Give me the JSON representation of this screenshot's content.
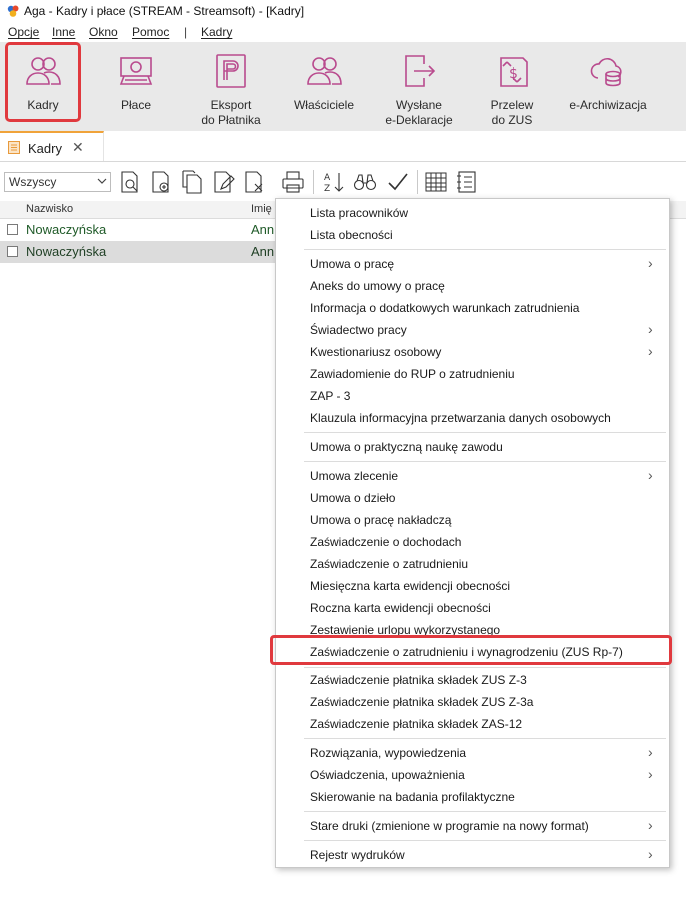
{
  "window": {
    "title": "Aga - Kadry i płace (STREAM - Streamsoft) - [Kadry]",
    "logo_icon": "aga-logo-icon"
  },
  "menubar": {
    "items": [
      {
        "label": "Opcje"
      },
      {
        "label": "Inne"
      },
      {
        "label": "Okno"
      },
      {
        "label": "Pomoc"
      }
    ],
    "separator": "|",
    "extra": {
      "label": "Kadry"
    }
  },
  "ribbon": {
    "buttons": [
      {
        "label": "Kadry",
        "icon": "people-icon",
        "selected": true
      },
      {
        "label": "Płace",
        "icon": "money-icon"
      },
      {
        "label": "Eksport\ndo Płatnika",
        "icon": "platnik-icon"
      },
      {
        "label": "Właściciele",
        "icon": "owner-icon"
      },
      {
        "label": "Wysłane\ne-Deklaracje",
        "icon": "export-doc-icon"
      },
      {
        "label": "Przelew\ndo ZUS",
        "icon": "transfer-icon"
      },
      {
        "label": "e-Archiwizacja",
        "icon": "database-cloud-icon"
      }
    ],
    "highlight_color": "#e0393e"
  },
  "tabs": [
    {
      "label": "Kadry",
      "close": "✕"
    }
  ],
  "toolbar": {
    "filter_value": "Wszyscy",
    "icons": [
      "preview-doc-icon",
      "add-doc-icon",
      "copy-doc-icon",
      "edit-doc-icon",
      "delete-doc-icon",
      "print-icon",
      "sort-az-icon",
      "binoculars-icon",
      "check-icon",
      "grid-icon",
      "list-settings-icon"
    ]
  },
  "grid": {
    "columns": [
      "Nazwisko",
      "Imię"
    ],
    "rows": [
      {
        "nazwisko": "Nowaczyńska",
        "imie": "Ann"
      },
      {
        "nazwisko": "Nowaczyńska",
        "imie": "Ann",
        "selected": true
      }
    ]
  },
  "context_menu": {
    "groups": [
      [
        {
          "label": "Lista pracowników"
        },
        {
          "label": "Lista obecności"
        }
      ],
      [
        {
          "label": "Umowa o pracę",
          "submenu": true
        },
        {
          "label": "Aneks do umowy o pracę"
        },
        {
          "label": "Informacja o dodatkowych warunkach zatrudnienia"
        },
        {
          "label": "Świadectwo pracy",
          "submenu": true
        },
        {
          "label": "Kwestionariusz osobowy",
          "submenu": true
        },
        {
          "label": "Zawiadomienie do RUP o zatrudnieniu"
        },
        {
          "label": "ZAP - 3"
        },
        {
          "label": "Klauzula informacyjna przetwarzania danych osobowych"
        }
      ],
      [
        {
          "label": "Umowa o praktyczną naukę zawodu"
        }
      ],
      [
        {
          "label": "Umowa zlecenie",
          "submenu": true
        },
        {
          "label": "Umowa o dzieło"
        },
        {
          "label": "Umowa o pracę nakładczą"
        },
        {
          "label": "Zaświadczenie o dochodach"
        },
        {
          "label": "Zaświadczenie o zatrudnieniu"
        },
        {
          "label": "Miesięczna karta ewidencji obecności"
        },
        {
          "label": "Roczna karta ewidencji obecności"
        },
        {
          "label": "Zestawienie urlopu wykorzystanego"
        },
        {
          "label": "Zaświadczenie o zatrudnieniu i wynagrodzeniu (ZUS Rp-7)",
          "highlighted": true
        }
      ],
      [
        {
          "label": "Zaświadczenie płatnika składek ZUS Z-3"
        },
        {
          "label": "Zaświadczenie płatnika składek ZUS Z-3a"
        },
        {
          "label": "Zaświadczenie płatnika składek ZAS-12"
        }
      ],
      [
        {
          "label": "Rozwiązania, wypowiedzenia",
          "submenu": true
        },
        {
          "label": "Oświadczenia, upoważnienia",
          "submenu": true
        },
        {
          "label": "Skierowanie na badania profilaktyczne"
        }
      ],
      [
        {
          "label": "Stare druki (zmienione w programie na nowy format)",
          "submenu": true
        }
      ],
      [
        {
          "label": "Rejestr wydruków",
          "submenu": true
        }
      ]
    ],
    "submenu_glyph": "›",
    "highlight_color": "#e0393e"
  }
}
